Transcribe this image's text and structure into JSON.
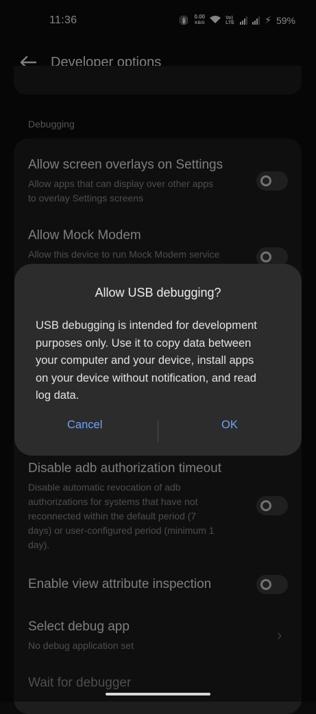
{
  "status_bar": {
    "time": "11:36",
    "net_speed_value": "0.00",
    "net_speed_unit": "KB/S",
    "volte_label": "Vo) LTE",
    "battery": "59%"
  },
  "app_bar": {
    "back_icon": "arrow-left-icon",
    "title": "Developer options"
  },
  "section": {
    "header": "Debugging"
  },
  "settings": [
    {
      "title": "Allow screen overlays on Settings",
      "subtitle_lines": [
        "Allow apps that can display over other apps",
        "to overlay Settings screens"
      ],
      "toggle_on": false
    },
    {
      "title": "Allow Mock Modem",
      "subtitle_lines": [
        "Allow this device to run Mock Modem service"
      ],
      "toggle_on": false
    },
    {
      "title": "Disable adb authorization timeout",
      "subtitle_lines": [
        "Disable automatic revocation of adb",
        "authorizations for systems that have not",
        "reconnected within the default period (7",
        "days) or user-configured period (minimum 1",
        "day)."
      ],
      "toggle_on": false
    },
    {
      "title": "Enable view attribute inspection",
      "toggle_on": false
    },
    {
      "title": "Select debug app",
      "subtitle_lines": [
        "No debug application set"
      ]
    },
    {
      "title": "Wait for debugger"
    }
  ],
  "dialog": {
    "title": "Allow USB debugging?",
    "body_lines": [
      "USB debugging is intended for development",
      "purposes only. Use it to copy data between",
      "your computer and your device, install apps",
      "on your device without notification, and read",
      "log data."
    ],
    "cancel_label": "Cancel",
    "ok_label": "OK"
  },
  "colors": {
    "accent": "#6ea3f5",
    "dialog_bg": "#2c2c2c",
    "card_bg": "#1d1d1d"
  }
}
